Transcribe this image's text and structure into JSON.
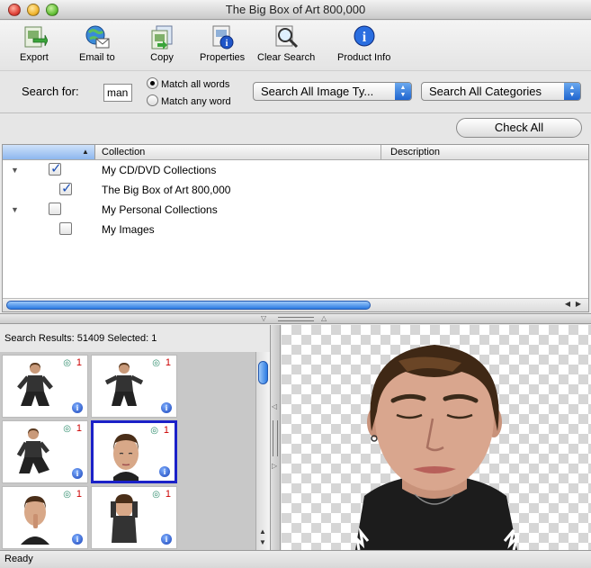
{
  "window": {
    "title": "The Big Box of Art 800,000"
  },
  "toolbar": {
    "export": "Export",
    "email": "Email to",
    "copy": "Copy",
    "properties": "Properties",
    "clear_search": "Clear Search",
    "product_info": "Product Info"
  },
  "search": {
    "label": "Search for:",
    "value": "man",
    "match_all": "Match all words",
    "match_any": "Match any word",
    "selected_match": "all",
    "image_type": "Search All Image Ty...",
    "categories": "Search All Categories"
  },
  "check_all": "Check All",
  "table": {
    "columns": {
      "collection": "Collection",
      "description": "Description"
    },
    "rows": [
      {
        "label": "My CD/DVD Collections",
        "checked": true,
        "level": 0,
        "expanded": true
      },
      {
        "label": "The Big Box of Art 800,000",
        "checked": true,
        "level": 1
      },
      {
        "label": "My Personal Collections",
        "checked": false,
        "level": 0,
        "expanded": true
      },
      {
        "label": "My Images",
        "checked": false,
        "level": 1
      }
    ]
  },
  "results": {
    "count_text": "Search Results: 51409",
    "selected_text": "Selected: 1",
    "thumbnails": [
      {
        "badge": "1",
        "selected": false
      },
      {
        "badge": "1",
        "selected": false
      },
      {
        "badge": "1",
        "selected": false
      },
      {
        "badge": "1",
        "selected": true
      },
      {
        "badge": "1",
        "selected": false
      },
      {
        "badge": "1",
        "selected": false
      }
    ]
  },
  "status": {
    "text": "Ready"
  },
  "colors": {
    "selection": "#1b21c8",
    "accent": "#2a7ae2",
    "badge": "#cc0000"
  }
}
